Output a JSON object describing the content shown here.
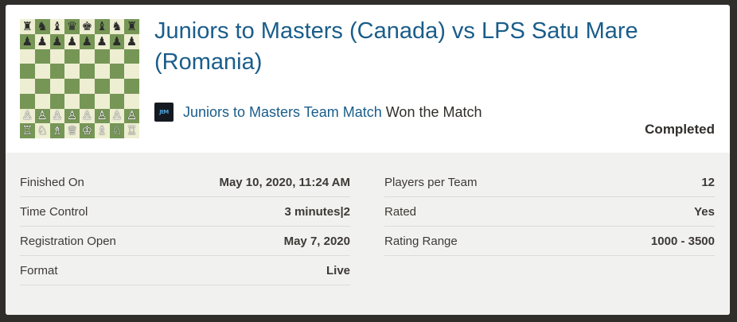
{
  "match": {
    "title": "Juniors to Masters (Canada) vs LPS Satu Mare (Romania)",
    "team_icon_text": "JtM",
    "team_link": "Juniors to Masters Team Match",
    "result": "Won the Match",
    "status": "Completed"
  },
  "board": {
    "rows": [
      [
        "♜",
        "♞",
        "♝",
        "♛",
        "♚",
        "♝",
        "♞",
        "♜"
      ],
      [
        "♟",
        "♟",
        "♟",
        "♟",
        "♟",
        "♟",
        "♟",
        "♟"
      ],
      [
        "",
        "",
        "",
        "",
        "",
        "",
        "",
        ""
      ],
      [
        "",
        "",
        "",
        "",
        "",
        "",
        "",
        ""
      ],
      [
        "",
        "",
        "",
        "",
        "",
        "",
        "",
        ""
      ],
      [
        "",
        "",
        "",
        "",
        "",
        "",
        "",
        ""
      ],
      [
        "♙",
        "♙",
        "♙",
        "♙",
        "♙",
        "♙",
        "♙",
        "♙"
      ],
      [
        "♖",
        "♘",
        "♗",
        "♕",
        "♔",
        "♗",
        "♘",
        "♖"
      ]
    ],
    "colors": {
      "light": "#eeeed2",
      "dark": "#769656"
    }
  },
  "details": {
    "left": [
      {
        "label": "Finished On",
        "value": "May 10, 2020, 11:24 AM"
      },
      {
        "label": "Time Control",
        "value": "3 minutes|2"
      },
      {
        "label": "Registration Open",
        "value": "May 7, 2020"
      },
      {
        "label": "Format",
        "value": "Live"
      }
    ],
    "right": [
      {
        "label": "Players per Team",
        "value": "12"
      },
      {
        "label": "Rated",
        "value": "Yes"
      },
      {
        "label": "Rating Range",
        "value": "1000 - 3500"
      }
    ]
  },
  "colors": {
    "accent": "#1a5d8a",
    "background": "#302e2b",
    "panel": "#f1f1ef"
  }
}
